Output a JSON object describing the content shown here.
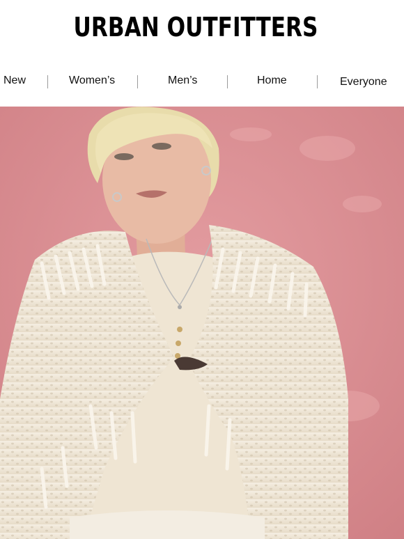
{
  "brand": {
    "logo_text": "URBAN OUTFITTERS"
  },
  "nav": {
    "items": [
      {
        "label": "New"
      },
      {
        "label": "Women’s"
      },
      {
        "label": "Men’s"
      },
      {
        "label": "Home"
      },
      {
        "label": "Everyone"
      }
    ]
  },
  "hero": {
    "icon": "model-photo",
    "colors": {
      "wall": "#d98a8e",
      "sweater": "#f1e8d8",
      "hair": "#eadfae",
      "skin": "#e6b8a2"
    }
  }
}
